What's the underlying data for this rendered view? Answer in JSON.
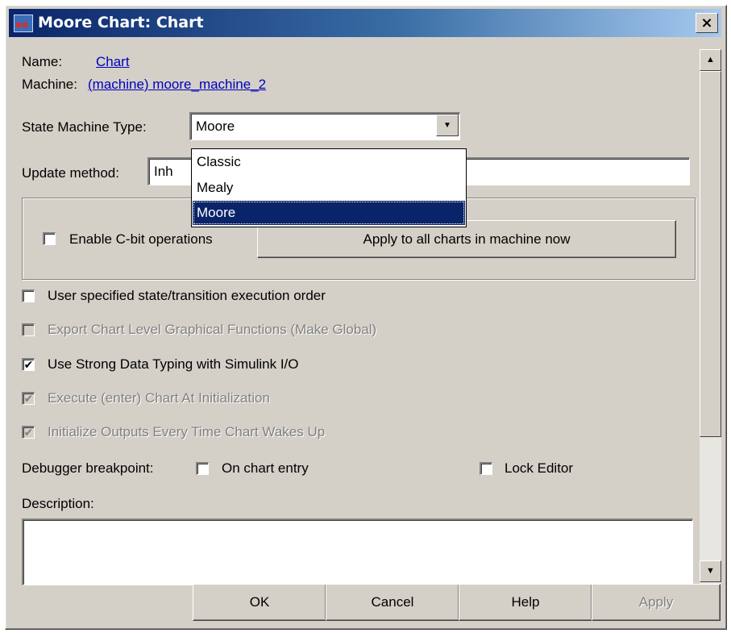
{
  "title": "Moore Chart: Chart",
  "name_label": "Name:",
  "name_value": "Chart",
  "machine_label": "Machine:",
  "machine_value": "(machine) moore_machine_2",
  "state_machine_type": {
    "label": "State Machine Type:",
    "value": "Moore",
    "options": [
      "Classic",
      "Mealy",
      "Moore"
    ],
    "selected": "Moore"
  },
  "update_method": {
    "label": "Update method:",
    "value": "Inh"
  },
  "cbit": {
    "label": "Enable C-bit operations",
    "checked": false,
    "apply_all_label": "Apply to all charts in machine now"
  },
  "options": [
    {
      "label": "User specified state/transition execution order",
      "checked": false,
      "enabled": true
    },
    {
      "label": "Export Chart Level Graphical Functions (Make Global)",
      "checked": false,
      "enabled": false
    },
    {
      "label": "Use Strong Data Typing with Simulink I/O",
      "checked": true,
      "enabled": true
    },
    {
      "label": "Execute (enter) Chart At Initialization",
      "checked": true,
      "enabled": false
    },
    {
      "label": "Initialize Outputs Every Time Chart Wakes Up",
      "checked": true,
      "enabled": false
    }
  ],
  "debugger": {
    "label": "Debugger breakpoint:",
    "on_entry_label": "On chart entry",
    "on_entry_checked": false
  },
  "lock_editor": {
    "label": "Lock Editor",
    "checked": false
  },
  "description_label": "Description:",
  "description_value": "",
  "buttons": {
    "ok": "OK",
    "cancel": "Cancel",
    "help": "Help",
    "apply": "Apply"
  },
  "close_glyph": "×",
  "check_glyph": "✔",
  "combo_arrow_glyph": "▼",
  "scroll_up_glyph": "▲",
  "scroll_down_glyph": "▼",
  "colors": {
    "face": "#d4d0c8",
    "title_start": "#0a246a",
    "title_end": "#a6caf0",
    "selection": "#0a246a",
    "link": "#0000c0"
  }
}
